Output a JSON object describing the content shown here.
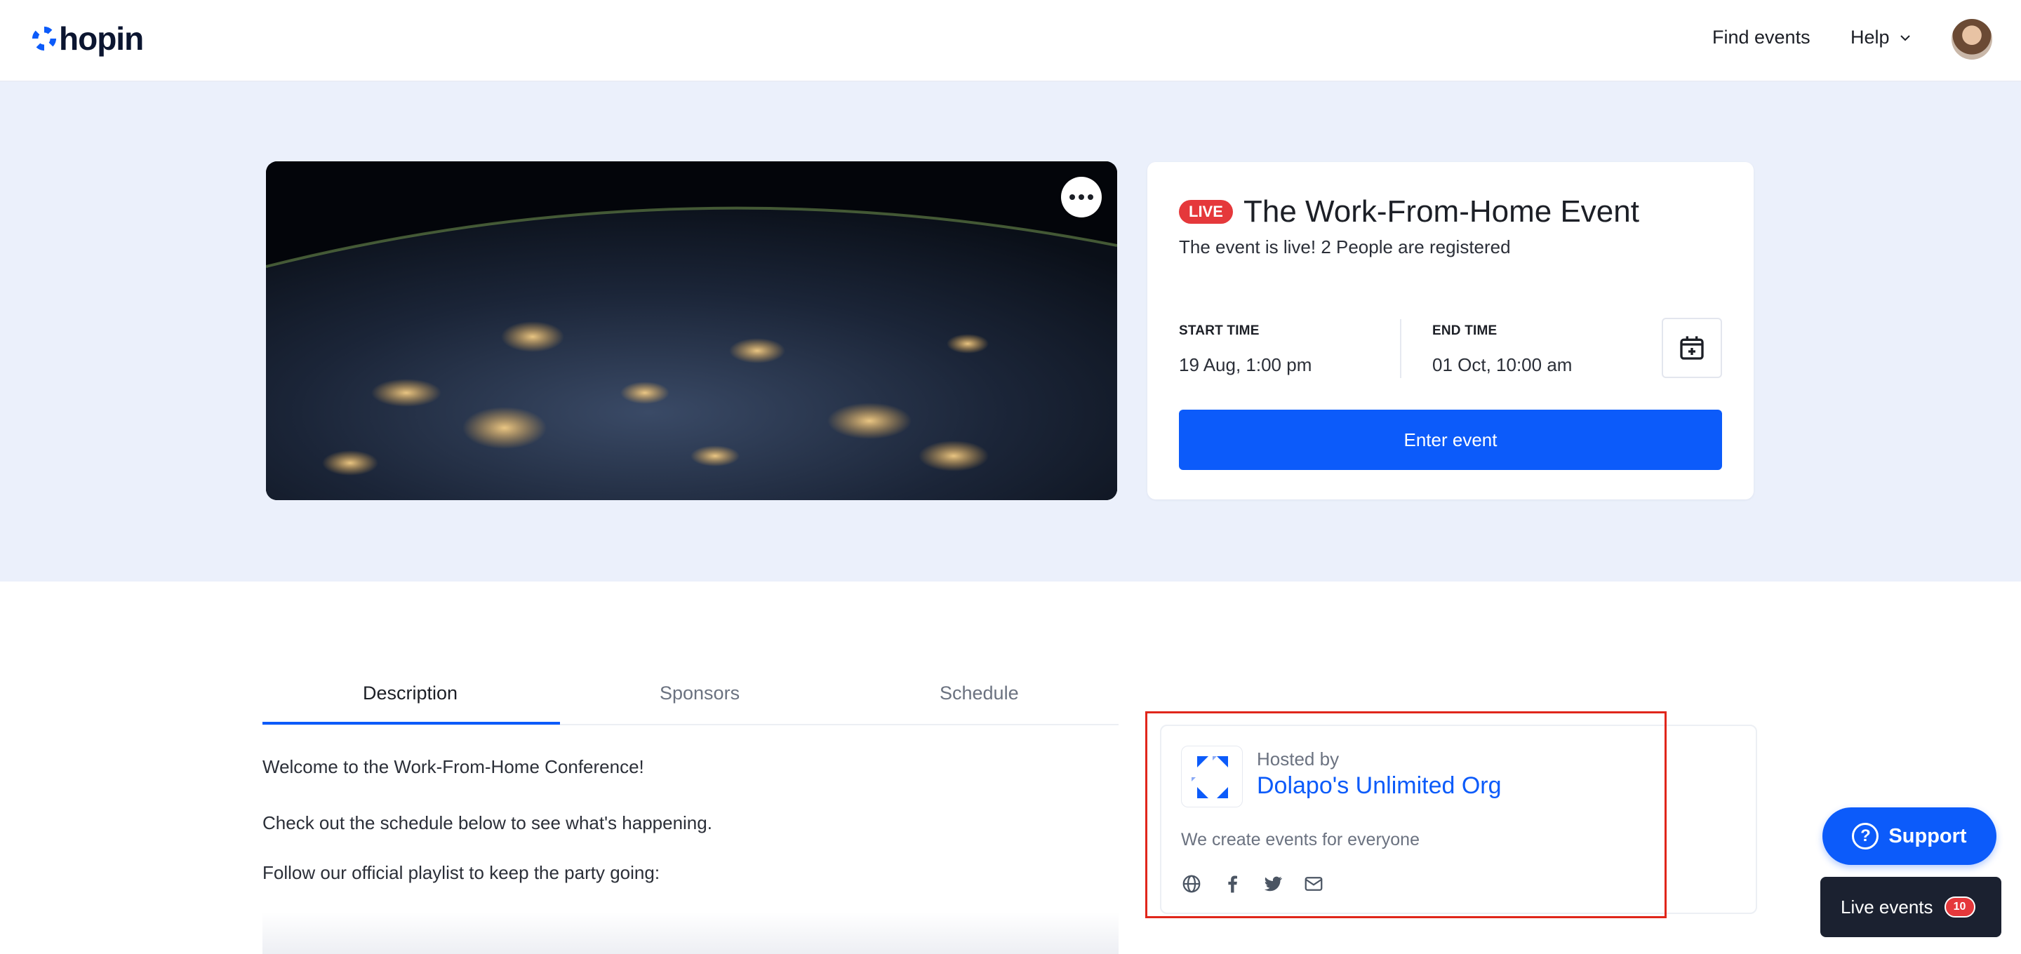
{
  "app": {
    "brand": "hopin",
    "colors": {
      "accent": "#0c5bfa",
      "live": "#e5383b",
      "hero_bg": "#ebf0fb",
      "highlight": "#e0261b"
    }
  },
  "header": {
    "nav": {
      "find_events": "Find events",
      "help": "Help"
    },
    "icons": {
      "help_chevron": "chevron-down-icon",
      "avatar": "user-avatar"
    }
  },
  "event": {
    "live_badge": "LIVE",
    "title": "The Work-From-Home Event",
    "subtitle": "The event is live! 2 People are registered",
    "start_label": "START TIME",
    "start_value": "19 Aug, 1:00 pm",
    "end_label": "END TIME",
    "end_value": "01 Oct, 10:00 am",
    "enter_button": "Enter event",
    "icons": {
      "more": "more-horizontal-icon",
      "calendar": "calendar-add-icon"
    }
  },
  "tabs": [
    {
      "label": "Description",
      "active": true
    },
    {
      "label": "Sponsors",
      "active": false
    },
    {
      "label": "Schedule",
      "active": false
    }
  ],
  "description": {
    "lines": [
      "Welcome to the Work-From-Home Conference!",
      "Check out the schedule below to see what's happening.",
      "Follow our official playlist to keep the party going:"
    ]
  },
  "host": {
    "hosted_by": "Hosted by",
    "org_name": "Dolapo's Unlimited Org",
    "tagline": "We create events for everyone",
    "socials": [
      "globe-icon",
      "facebook-icon",
      "twitter-icon",
      "mail-icon"
    ]
  },
  "floating": {
    "support": "Support",
    "live_events": "Live events",
    "live_events_count": "10"
  }
}
